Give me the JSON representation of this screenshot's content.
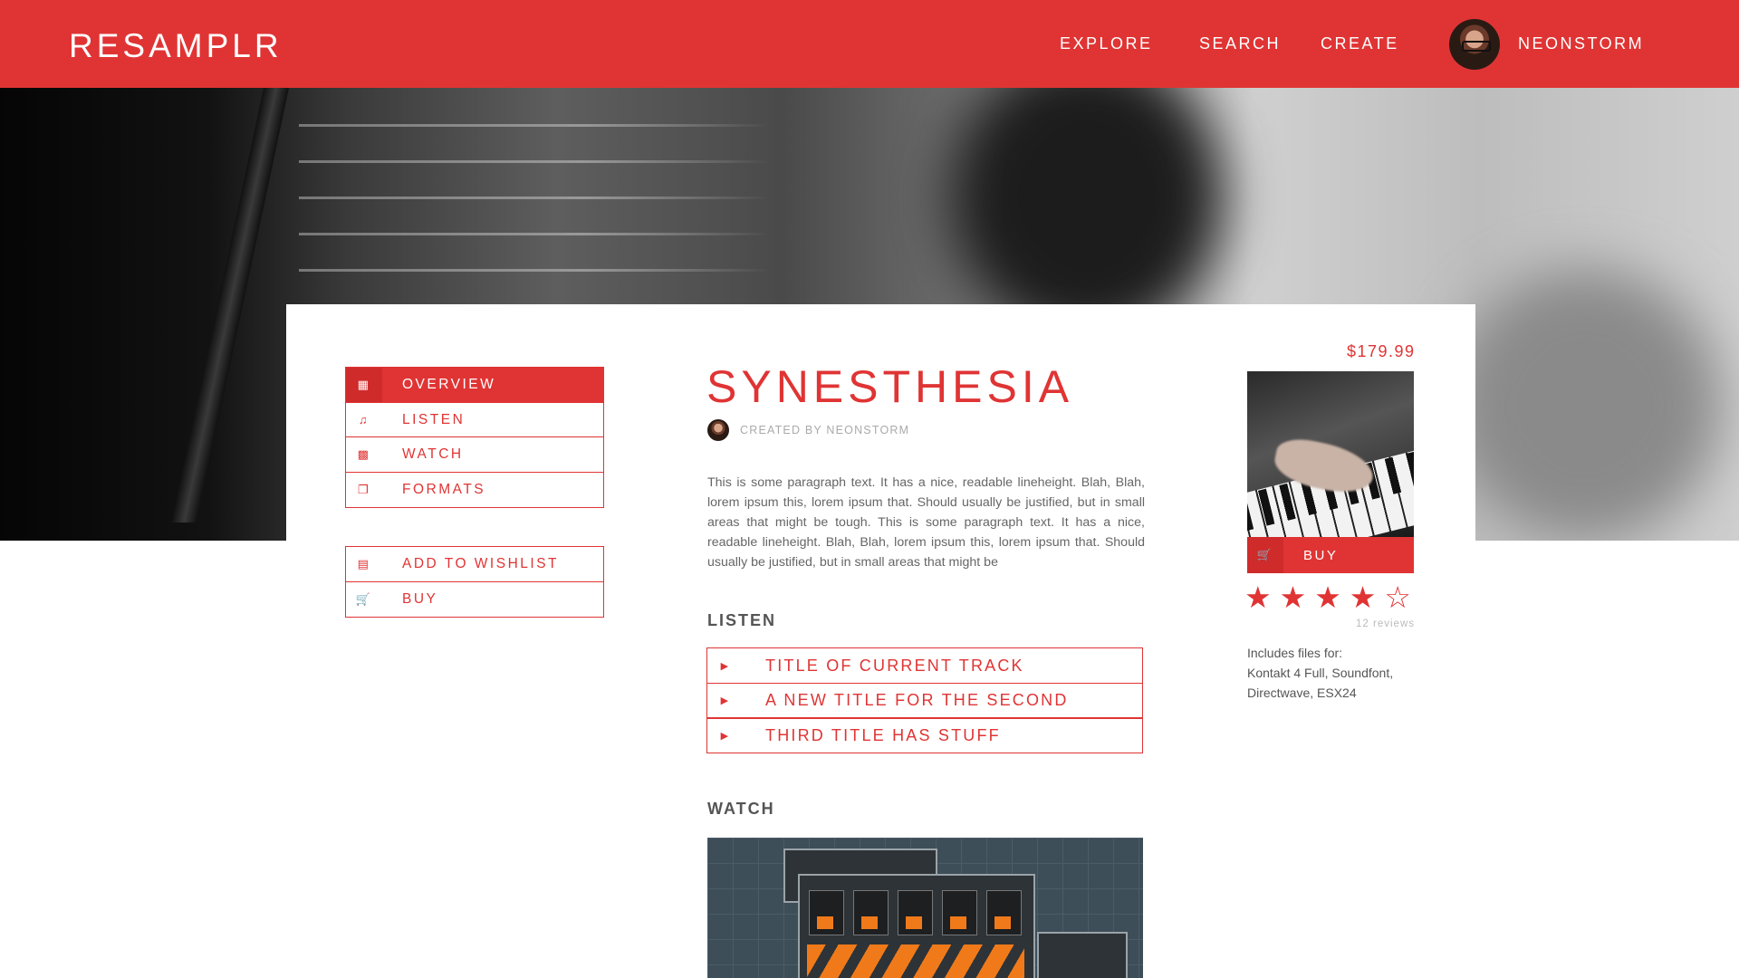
{
  "app": {
    "title": "RESAMPLR"
  },
  "nav": {
    "explore": "EXPLORE",
    "search": "SEARCH",
    "create": "CREATE",
    "user": "NEONSTORM"
  },
  "sidenav": {
    "items": [
      {
        "label": "OVERVIEW",
        "icon": "map-icon",
        "active": true
      },
      {
        "label": "LISTEN",
        "icon": "music-note-icon",
        "active": false
      },
      {
        "label": "WATCH",
        "icon": "film-icon",
        "active": false
      },
      {
        "label": "FORMATS",
        "icon": "files-icon",
        "active": false
      }
    ],
    "actions": [
      {
        "label": "ADD TO WISHLIST",
        "icon": "list-icon"
      },
      {
        "label": "BUY",
        "icon": "cart-icon"
      }
    ]
  },
  "product": {
    "title": "SYNESTHESIA",
    "creator": "CREATED BY NEONSTORM",
    "description": "This is some paragraph text.  It has a nice, readable lineheight.  Blah, Blah, lorem ipsum this, lorem ipsum that.  Should usually be justified, but in small areas that might be tough.  This is some paragraph text.  It has a nice, readable lineheight.  Blah, Blah, lorem ipsum this, lorem ipsum that.  Should usually be justified, but in small areas that might be",
    "price": "$179.99",
    "buy_label": "BUY",
    "rating": 4,
    "rating_max": 5,
    "reviews": "12 reviews",
    "includes_label": "Includes files for:",
    "includes_files": "Kontakt 4 Full, Soundfont, Directwave, ESX24"
  },
  "listen": {
    "heading": "LISTEN",
    "tracks": [
      "TITLE OF CURRENT TRACK",
      "A NEW TITLE FOR THE SECOND",
      "THIRD TITLE HAS STUFF"
    ]
  },
  "watch": {
    "heading": "WATCH"
  },
  "colors": {
    "accent": "#e03434",
    "accent_dark": "#cf2b2b",
    "text": "#555555"
  }
}
